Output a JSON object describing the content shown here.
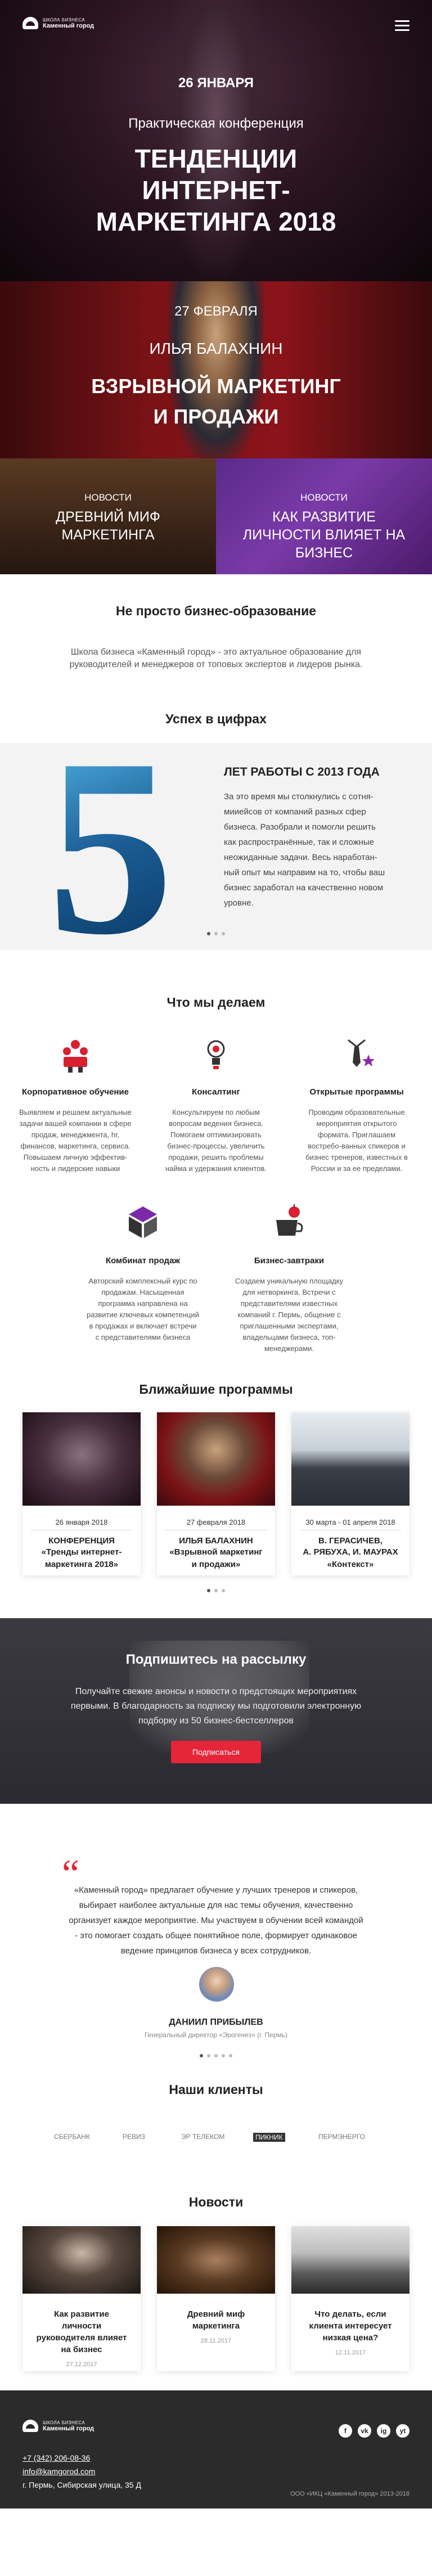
{
  "header": {
    "logo_small": "Школа бизнеса",
    "logo_big": "Каменный город"
  },
  "hero": {
    "date": "26 ЯНВАРЯ",
    "subtitle": "Практическая конференция",
    "title_lines": [
      "ТЕНДЕНЦИИ",
      "ИНТЕРНЕТ-",
      "МАРКЕТИНГА 2018"
    ]
  },
  "promo": {
    "date": "27 ФЕВРАЛЯ",
    "name": "ИЛЬЯ БАЛАХНИН",
    "title_lines": [
      "ВЗРЫВНОЙ МАРКЕТИНГ",
      "И ПРОДАЖИ"
    ]
  },
  "tiles": [
    {
      "category": "НОВОСТИ",
      "title": "ДРЕВНИЙ МИФ МАРКЕТИНГА"
    },
    {
      "category": "НОВОСТИ",
      "title": "КАК РАЗВИТИЕ ЛИЧНОСТИ ВЛИЯЕТ НА БИЗНЕС"
    }
  ],
  "intro": {
    "title": "Не просто бизнес-образование",
    "text": "Школа бизнеса «Каменный город» - это актуальное образование для руководителей и менеджеров от топовых экспертов и лидеров рынка."
  },
  "facts": {
    "title": "Успех в цифрах",
    "number": "5",
    "heading": "ЛЕТ РАБОТЫ С 2013 ГОДА",
    "text": "За это время мы столкнулись с сотня-мииейсов от компаний разных сфер бизнеса. Разобрали и помогли решить как распространённые, так и сложные неожиданные задачи. Весь наработан-ный опыт мы направим на то, чтобы ваш бизнес заработал на качественно новом уровне."
  },
  "services": {
    "title": "Что мы делаем",
    "items": [
      {
        "name": "Корпоративное обучение",
        "desc": "Выявляем и решаем актуальные задачи вашей компании в сфере продаж, менеджмента, hr, финансов, маркетинга, сервиса. Повышаем личную эффектив-ность и лидерские навыки"
      },
      {
        "name": "Консалтинг",
        "desc": "Консультируем по любым вопросам ведения бизнеса. Помогаем оптимизировать бизнес-процессы, увеличить продажи, решить проблемы найма и удержания клиентов."
      },
      {
        "name": "Открытые программы",
        "desc": "Проводим образовательные мероприятия открытого формата. Приглашаем востребо-ванных спикеров и бизнес тренеров, известных в России и за ее пределами."
      },
      {
        "name": "Комбинат продаж",
        "desc": "Авторский комплексный курс по продажам. Насыщенная программа направлена на развитие ключевых компетенций в продажах и включает встречи с представителями бизнеса"
      },
      {
        "name": "Бизнес-завтраки",
        "desc": "Создаем уникальную площадку для нетворкинга. Встречи с представителями известных компаний г. Пермь, общение с приглашенными экспертами, владельцами бизнеса, топ-менеджерами."
      }
    ]
  },
  "programs": {
    "title": "Ближайшие программы",
    "items": [
      {
        "date": "26 января 2018",
        "name": "КОНФЕРЕНЦИЯ",
        "sub_lines": [
          "«Тренды интернет-",
          "маркетинга 2018»"
        ]
      },
      {
        "date": "27 февраля 2018",
        "name": "ИЛЬЯ БАЛАХНИН",
        "sub_lines": [
          "«Взрывной маркетинг",
          "и продажи»"
        ]
      },
      {
        "date": "30 марта - 01 апреля 2018",
        "name": "В. ГЕРАСИЧЕВ,",
        "sub_lines": [
          "А. РЯБУХА, И. МАУРАХ",
          "«Контекст»"
        ]
      }
    ]
  },
  "subscribe": {
    "title": "Подпишитесь на рассылку",
    "text": "Получайте свежие анонсы и новости о предстоящих мероприятиях первыми. В благодарность за подписку мы подготовили электронную подборку из 50 бизнес-бестселлеров",
    "button": "Подписаться"
  },
  "testimonial": {
    "quote_mark": "“",
    "text": "«Каменный город» предлагает обучение у лучших тренеров и спикеров, выбирает наиболее актуальные для нас темы обучения, качественно организует каждое мероприятие. Мы участвуем в обучении всей командой - это помогает создать общее понятийное поле, формирует одинаковое ведение принципов бизнеса у всех сотрудников.",
    "name": "ДАНИИЛ ПРИБЫЛЕВ",
    "role": "Генеральный директор «Эрогенез» (г. Пермь)"
  },
  "clients": {
    "title": "Наши клиенты",
    "items": [
      "СБЕРБАНК",
      "РЕВИЗ",
      "ЭР ТЕЛЕКОМ",
      "ПИКНИК",
      "ПЕРМЭНЕРГО"
    ]
  },
  "news": {
    "title": "Новости",
    "items": [
      {
        "title": "Как развитие личности руководителя влияет на бизнес",
        "date": "27.12.2017"
      },
      {
        "title": "Древний миф маркетинга",
        "date": "28.11.2017"
      },
      {
        "title": "Что делать, если клиента интересует низкая цена?",
        "date": "12.11.2017"
      }
    ]
  },
  "footer": {
    "logo_small": "Школа бизнеса",
    "logo_big": "Каменный город",
    "phone": "+7 (342) 206-08-36",
    "email": "info@kamgorod.com",
    "address": "г. Пермь, Сибирская улица, 35 Д",
    "copyright": "ООО «ИКЦ «Каменный город» 2013-2018",
    "socials": [
      "f",
      "vk",
      "ig",
      "yt"
    ]
  },
  "colors": {
    "accent": "#e6243a",
    "dark": "#2b2b2b",
    "five_blue": "#1c6da6"
  }
}
